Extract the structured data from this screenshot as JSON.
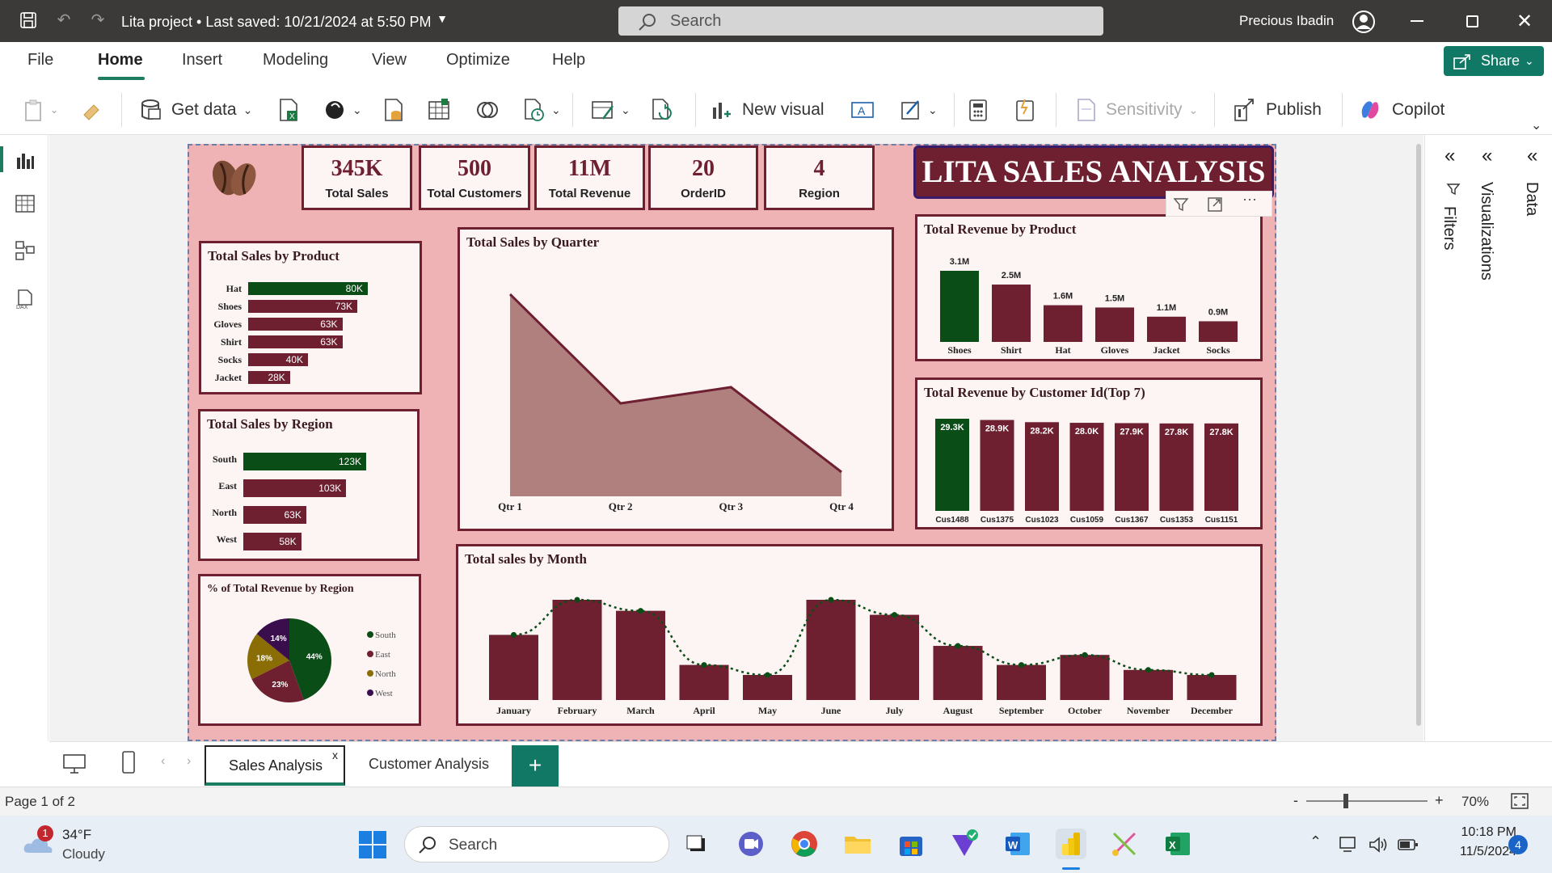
{
  "titlebar": {
    "doc_title": "Lita project • Last saved: 10/21/2024 at 5:50 PM",
    "search_placeholder": "Search",
    "user_name": "Precious Ibadin"
  },
  "menu": {
    "items": [
      "File",
      "Home",
      "Insert",
      "Modeling",
      "View",
      "Optimize",
      "Help"
    ],
    "active": "Home",
    "share_label": "Share"
  },
  "ribbon": {
    "get_data": "Get data",
    "new_visual": "New visual",
    "sensitivity": "Sensitivity",
    "publish": "Publish",
    "copilot": "Copilot"
  },
  "dashboard": {
    "title": "LITA SALES ANALYSIS",
    "kpis": [
      {
        "value": "345K",
        "label": "Total Sales"
      },
      {
        "value": "500",
        "label": "Total Customers"
      },
      {
        "value": "11M",
        "label": "Total Revenue"
      },
      {
        "value": "20",
        "label": "OrderID"
      },
      {
        "value": "4",
        "label": "Region"
      }
    ],
    "colors": {
      "dark_red": "#6e2030",
      "dark_green": "#0b4d17",
      "background": "#efb3b6",
      "area_fill": "#b0807f",
      "olive": "#8a6d05",
      "purple": "#3a0d4d"
    }
  },
  "chart_data": [
    {
      "type": "bar",
      "orientation": "horizontal",
      "title": "Total Sales by Product",
      "categories": [
        "Hat",
        "Shoes",
        "Gloves",
        "Shirt",
        "Socks",
        "Jacket"
      ],
      "values": [
        80,
        73,
        63,
        63,
        40,
        28
      ],
      "labels": [
        "80K",
        "73K",
        "63K",
        "63K",
        "40K",
        "28K"
      ]
    },
    {
      "type": "bar",
      "orientation": "horizontal",
      "title": "Total Sales by Region",
      "categories": [
        "South",
        "East",
        "North",
        "West"
      ],
      "values": [
        123,
        103,
        63,
        58
      ],
      "labels": [
        "123K",
        "103K",
        "63K",
        "58K"
      ]
    },
    {
      "type": "pie",
      "title": "% of Total Revenue by Region",
      "categories": [
        "South",
        "East",
        "North",
        "West"
      ],
      "values": [
        44,
        23,
        18,
        14
      ],
      "labels": [
        "44%",
        "23%",
        "18%",
        "14%"
      ]
    },
    {
      "type": "area",
      "title": "Total Sales by Quarter",
      "categories": [
        "Qtr 1",
        "Qtr 2",
        "Qtr 3",
        "Qtr 4"
      ],
      "values": [
        100,
        46,
        54,
        12
      ]
    },
    {
      "type": "bar",
      "title": "Total Revenue by Product",
      "categories": [
        "Shoes",
        "Shirt",
        "Hat",
        "Gloves",
        "Jacket",
        "Socks"
      ],
      "values": [
        3.1,
        2.5,
        1.6,
        1.5,
        1.1,
        0.9
      ],
      "labels": [
        "3.1M",
        "2.5M",
        "1.6M",
        "1.5M",
        "1.1M",
        "0.9M"
      ]
    },
    {
      "type": "bar",
      "title": "Total Revenue by Customer Id(Top 7)",
      "categories": [
        "Cus1488",
        "Cus1375",
        "Cus1023",
        "Cus1059",
        "Cus1367",
        "Cus1353",
        "Cus1151"
      ],
      "values": [
        29.3,
        28.9,
        28.2,
        28.0,
        27.9,
        27.8,
        27.8
      ],
      "labels": [
        "29.3K",
        "28.9K",
        "28.2K",
        "28.0K",
        "27.9K",
        "27.8K",
        "27.8K"
      ]
    },
    {
      "type": "bar",
      "title": "Total sales by Month",
      "categories": [
        "January",
        "February",
        "March",
        "April",
        "May",
        "June",
        "July",
        "August",
        "September",
        "October",
        "November",
        "December"
      ],
      "values": [
        65,
        100,
        89,
        35,
        25,
        100,
        85,
        54,
        35,
        45,
        30,
        25
      ]
    }
  ],
  "tabs": {
    "items": [
      "Sales Analysis",
      "Customer Analysis"
    ],
    "active": "Sales Analysis",
    "close": "x",
    "add": "+"
  },
  "status": {
    "page": "Page 1 of 2",
    "zoom": "70%"
  },
  "panes": {
    "filters": "Filters",
    "visualizations": "Visualizations",
    "data": "Data"
  },
  "taskbar": {
    "weather_temp": "34°F",
    "weather_desc": "Cloudy",
    "weather_badge": "1",
    "search": "Search",
    "time": "10:18 PM",
    "date": "11/5/2024",
    "notif_count": "4"
  }
}
